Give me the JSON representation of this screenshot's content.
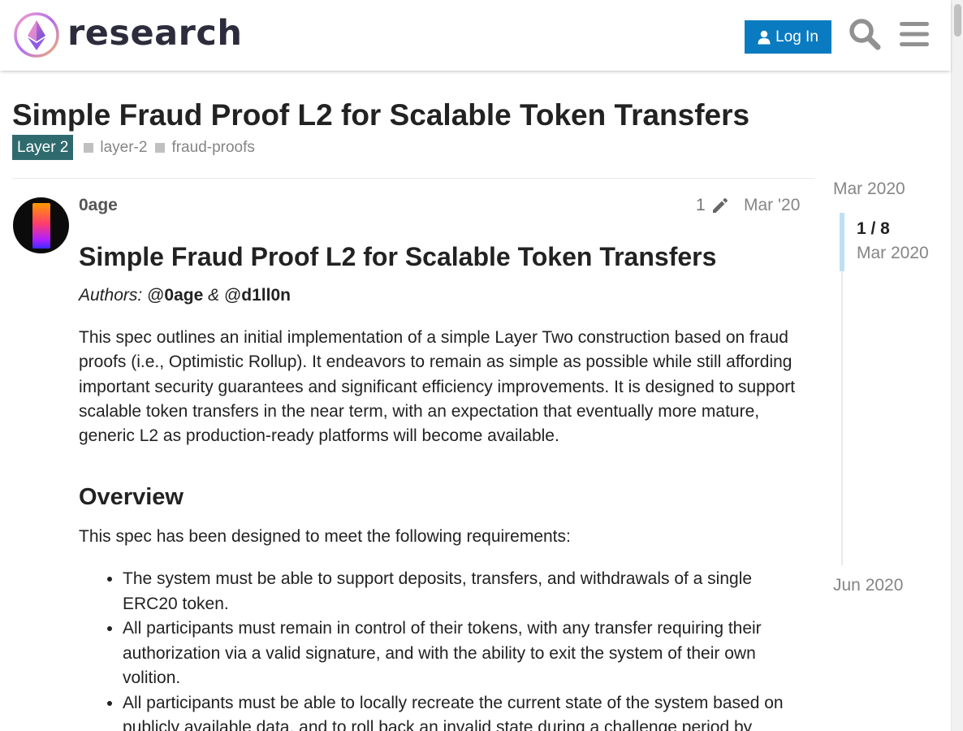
{
  "header": {
    "logo_text": "research",
    "login_label": "Log In"
  },
  "topic": {
    "title": "Simple Fraud Proof L2 for Scalable Token Transfers",
    "category": "Layer 2",
    "category_color": "#2f6b6e",
    "tags": [
      "layer-2",
      "fraud-proofs"
    ]
  },
  "post": {
    "username": "0age",
    "edit_count": "1",
    "date": "Mar '20",
    "heading": "Simple Fraud Proof L2 for Scalable Token Transfers",
    "authors_label": "Authors:",
    "author1": "0age",
    "author_sep": "&",
    "author2": "d1ll0n",
    "intro": "This spec outlines an initial implementation of a simple Layer Two construction based on fraud proofs (i.e., Optimistic Rollup). It endeavors to remain as simple as possible while still affording important security guarantees and significant efficiency improvements. It is designed to support scalable token transfers in the near term, with an expectation that eventually more mature, generic L2 as production-ready platforms will become available.",
    "overview_heading": "Overview",
    "overview_text": "This spec has been designed to meet the following requirements:",
    "requirements": [
      "The system must be able to support deposits, transfers, and withdrawals of a single ERC20 token.",
      "All participants must remain in control of their tokens, with any transfer requiring their authorization via a valid signature, and with the ability to exit the system of their own volition.",
      "All participants must be able to locally recreate the current state of the system based on publicly available data, and to roll back an invalid state during a challenge period by"
    ]
  },
  "timeline": {
    "start": "Mar 2020",
    "position": "1 / 8",
    "position_date": "Mar 2020",
    "end": "Jun 2020"
  },
  "colors": {
    "accent": "#0a7bc1",
    "timeline_handle": "#bfe0f2"
  }
}
